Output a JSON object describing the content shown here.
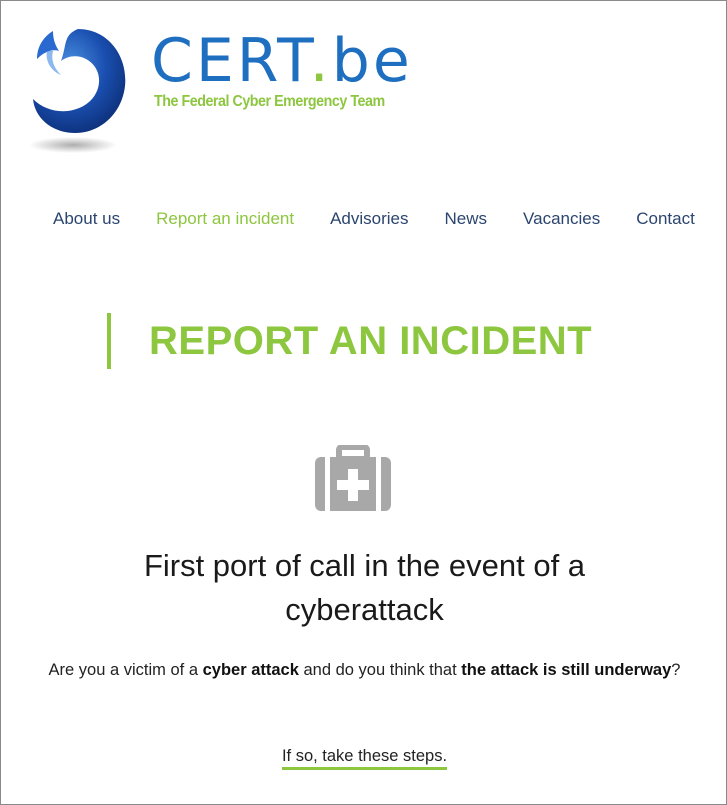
{
  "header": {
    "logo_word": "CERT",
    "logo_dot": ".",
    "logo_suffix": "be",
    "tagline": "The Federal Cyber Emergency Team"
  },
  "nav": {
    "items": [
      {
        "label": "About us",
        "active": false
      },
      {
        "label": "Report an incident",
        "active": true
      },
      {
        "label": "Advisories",
        "active": false
      },
      {
        "label": "News",
        "active": false
      },
      {
        "label": "Vacancies",
        "active": false
      },
      {
        "label": "Contact",
        "active": false
      }
    ]
  },
  "page": {
    "title": "REPORT AN INCIDENT",
    "icon": "first-aid-kit-icon",
    "headline": "First port of call in the event of a cyberattack",
    "lead_parts": [
      "Are you a victim of a ",
      "cyber attack",
      " and do you think that ",
      "the attack is still underway",
      "?"
    ],
    "steps_link": "If so, take these steps."
  },
  "colors": {
    "brand_blue": "#1f6fc0",
    "brand_green": "#8dc63f",
    "nav_text": "#2b4570"
  }
}
